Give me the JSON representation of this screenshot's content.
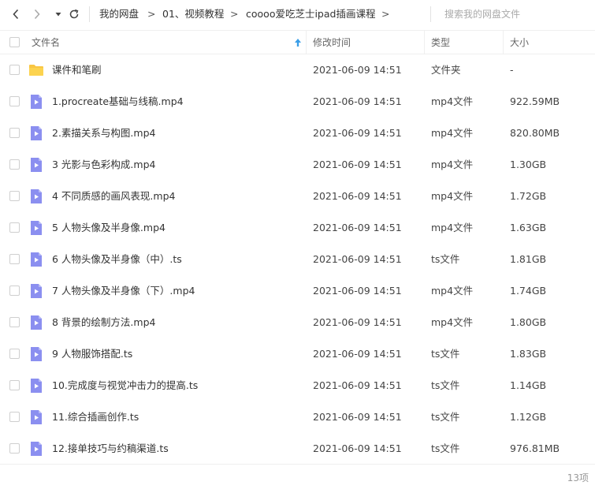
{
  "nav": {
    "breadcrumb": [
      "我的网盘",
      "01、视频教程",
      "coooo爱吃芝士ipad插画课程"
    ],
    "search_placeholder": "搜索我的网盘文件"
  },
  "columns": {
    "name": "文件名",
    "modified": "修改时间",
    "type": "类型",
    "size": "大小"
  },
  "files": [
    {
      "name": "课件和笔刷",
      "modified": "2021-06-09 14:51",
      "type": "文件夹",
      "size": "-",
      "icon": "folder-icon"
    },
    {
      "name": "1.procreate基础与线稿.mp4",
      "modified": "2021-06-09 14:51",
      "type": "mp4文件",
      "size": "922.59MB",
      "icon": "video-file-icon"
    },
    {
      "name": "2.素描关系与构图.mp4",
      "modified": "2021-06-09 14:51",
      "type": "mp4文件",
      "size": "820.80MB",
      "icon": "video-file-icon"
    },
    {
      "name": "3 光影与色彩构成.mp4",
      "modified": "2021-06-09 14:51",
      "type": "mp4文件",
      "size": "1.30GB",
      "icon": "video-file-icon"
    },
    {
      "name": "4 不同质感的画风表现.mp4",
      "modified": "2021-06-09 14:51",
      "type": "mp4文件",
      "size": "1.72GB",
      "icon": "video-file-icon"
    },
    {
      "name": "5 人物头像及半身像.mp4",
      "modified": "2021-06-09 14:51",
      "type": "mp4文件",
      "size": "1.63GB",
      "icon": "video-file-icon"
    },
    {
      "name": "6 人物头像及半身像（中）.ts",
      "modified": "2021-06-09 14:51",
      "type": "ts文件",
      "size": "1.81GB",
      "icon": "video-file-icon"
    },
    {
      "name": "7 人物头像及半身像（下）.mp4",
      "modified": "2021-06-09 14:51",
      "type": "mp4文件",
      "size": "1.74GB",
      "icon": "video-file-icon"
    },
    {
      "name": "8 背景的绘制方法.mp4",
      "modified": "2021-06-09 14:51",
      "type": "mp4文件",
      "size": "1.80GB",
      "icon": "video-file-icon"
    },
    {
      "name": "9 人物服饰搭配.ts",
      "modified": "2021-06-09 14:51",
      "type": "ts文件",
      "size": "1.83GB",
      "icon": "video-file-icon"
    },
    {
      "name": "10.完成度与视觉冲击力的提高.ts",
      "modified": "2021-06-09 14:51",
      "type": "ts文件",
      "size": "1.14GB",
      "icon": "video-file-icon"
    },
    {
      "name": "11.综合插画创作.ts",
      "modified": "2021-06-09 14:51",
      "type": "ts文件",
      "size": "1.12GB",
      "icon": "video-file-icon"
    },
    {
      "name": "12.接单技巧与约稿渠道.ts",
      "modified": "2021-06-09 14:51",
      "type": "ts文件",
      "size": "976.81MB",
      "icon": "video-file-icon"
    }
  ],
  "footer": {
    "count": "13项"
  },
  "colors": {
    "folder": "#f9c643",
    "video": "#8b8ff0",
    "sort_arrow": "#3a9ee8"
  }
}
